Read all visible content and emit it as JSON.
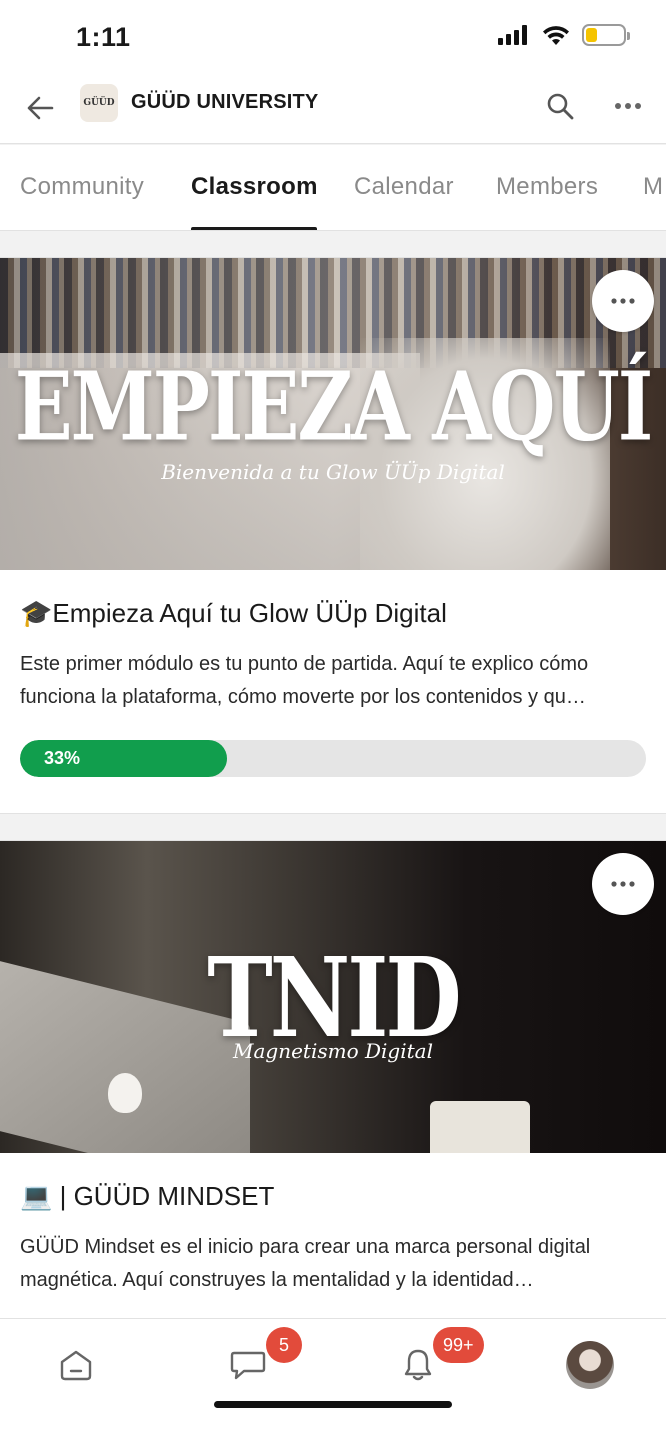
{
  "status_bar": {
    "time": "1:11"
  },
  "header": {
    "group_logo_text": "GÜÜD",
    "group_name": "GÜÜD UNIVERSITY"
  },
  "tabs": [
    {
      "label": "Community",
      "active": false
    },
    {
      "label": "Classroom",
      "active": true
    },
    {
      "label": "Calendar",
      "active": false
    },
    {
      "label": "Members",
      "active": false
    },
    {
      "label": "M",
      "active": false
    }
  ],
  "courses": [
    {
      "cover_title": "EMPIEZA AQUÍ",
      "cover_subtitle": "Bienvenida a tu Glow ÜÜp Digital",
      "title": "🎓Empieza Aquí tu Glow ÜÜp Digital",
      "description": "Este primer módulo es tu punto de partida. Aquí te explico cómo funciona la plataforma, cómo moverte por los contenidos y qu…",
      "progress": 0.33,
      "progress_label": "33%"
    },
    {
      "cover_title": "TNID",
      "cover_subtitle": "Magnetismo Digital",
      "title": "💻 | GÜÜD MINDSET",
      "description": "GÜÜD Mindset es el inicio para crear una marca personal digital magnética. Aquí construyes la mentalidad y la identidad…"
    }
  ],
  "bottom_nav": {
    "chat_badge": "5",
    "notifications_badge": "99+"
  },
  "colors": {
    "progress": "#119e4d",
    "badge": "#e24b3b",
    "active_tab": "#1a1a1a"
  }
}
